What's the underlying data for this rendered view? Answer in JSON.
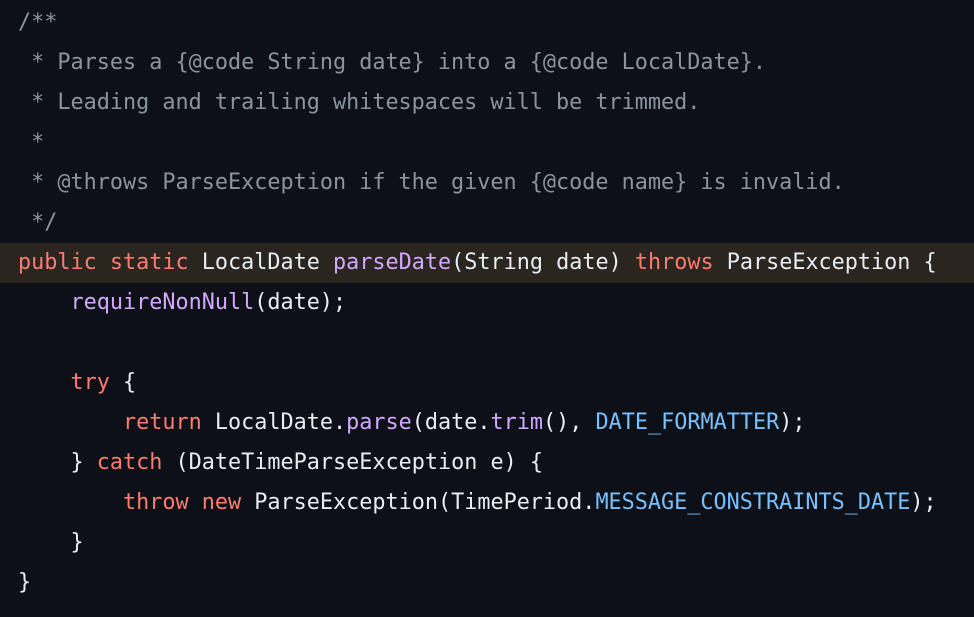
{
  "colors": {
    "background": "#0d1117",
    "highlight_line": "#2b2520",
    "comment": "#8b949e",
    "keyword": "#ff7b72",
    "function": "#d2a8ff",
    "constant": "#79c0ff",
    "plain": "#e6edf3"
  },
  "lines": [
    {
      "highlight": false,
      "tokens": [
        {
          "t": "/**",
          "c": "comment"
        }
      ]
    },
    {
      "highlight": false,
      "tokens": [
        {
          "t": " * Parses a {@code String date} into a {@code LocalDate}.",
          "c": "comment"
        }
      ]
    },
    {
      "highlight": false,
      "tokens": [
        {
          "t": " * Leading and trailing whitespaces will be trimmed.",
          "c": "comment"
        }
      ]
    },
    {
      "highlight": false,
      "tokens": [
        {
          "t": " *",
          "c": "comment"
        }
      ]
    },
    {
      "highlight": false,
      "tokens": [
        {
          "t": " * @throws ParseException if the given {@code name} is invalid.",
          "c": "comment"
        }
      ]
    },
    {
      "highlight": false,
      "tokens": [
        {
          "t": " */",
          "c": "comment"
        }
      ]
    },
    {
      "highlight": true,
      "tokens": [
        {
          "t": "public",
          "c": "keyword"
        },
        {
          "t": " ",
          "c": "plain"
        },
        {
          "t": "static",
          "c": "keyword"
        },
        {
          "t": " LocalDate ",
          "c": "plain"
        },
        {
          "t": "parseDate",
          "c": "func"
        },
        {
          "t": "(String date) ",
          "c": "plain"
        },
        {
          "t": "throws",
          "c": "keyword"
        },
        {
          "t": " ParseException {",
          "c": "plain"
        }
      ]
    },
    {
      "highlight": false,
      "tokens": [
        {
          "t": "    ",
          "c": "plain"
        },
        {
          "t": "requireNonNull",
          "c": "func"
        },
        {
          "t": "(date);",
          "c": "plain"
        }
      ]
    },
    {
      "highlight": false,
      "tokens": [
        {
          "t": "",
          "c": "plain"
        }
      ]
    },
    {
      "highlight": false,
      "tokens": [
        {
          "t": "    ",
          "c": "plain"
        },
        {
          "t": "try",
          "c": "keyword"
        },
        {
          "t": " {",
          "c": "plain"
        }
      ]
    },
    {
      "highlight": false,
      "tokens": [
        {
          "t": "        ",
          "c": "plain"
        },
        {
          "t": "return",
          "c": "keyword"
        },
        {
          "t": " LocalDate.",
          "c": "plain"
        },
        {
          "t": "parse",
          "c": "func"
        },
        {
          "t": "(date.",
          "c": "plain"
        },
        {
          "t": "trim",
          "c": "func"
        },
        {
          "t": "(), ",
          "c": "plain"
        },
        {
          "t": "DATE_FORMATTER",
          "c": "const"
        },
        {
          "t": ");",
          "c": "plain"
        }
      ]
    },
    {
      "highlight": false,
      "tokens": [
        {
          "t": "    } ",
          "c": "plain"
        },
        {
          "t": "catch",
          "c": "keyword"
        },
        {
          "t": " (DateTimeParseException e) {",
          "c": "plain"
        }
      ]
    },
    {
      "highlight": false,
      "tokens": [
        {
          "t": "        ",
          "c": "plain"
        },
        {
          "t": "throw",
          "c": "keyword"
        },
        {
          "t": " ",
          "c": "plain"
        },
        {
          "t": "new",
          "c": "keyword"
        },
        {
          "t": " ParseException(TimePeriod.",
          "c": "plain"
        },
        {
          "t": "MESSAGE_CONSTRAINTS_DATE",
          "c": "const"
        },
        {
          "t": ");",
          "c": "plain"
        }
      ]
    },
    {
      "highlight": false,
      "tokens": [
        {
          "t": "    }",
          "c": "plain"
        }
      ]
    },
    {
      "highlight": false,
      "tokens": [
        {
          "t": "}",
          "c": "plain"
        }
      ]
    }
  ]
}
